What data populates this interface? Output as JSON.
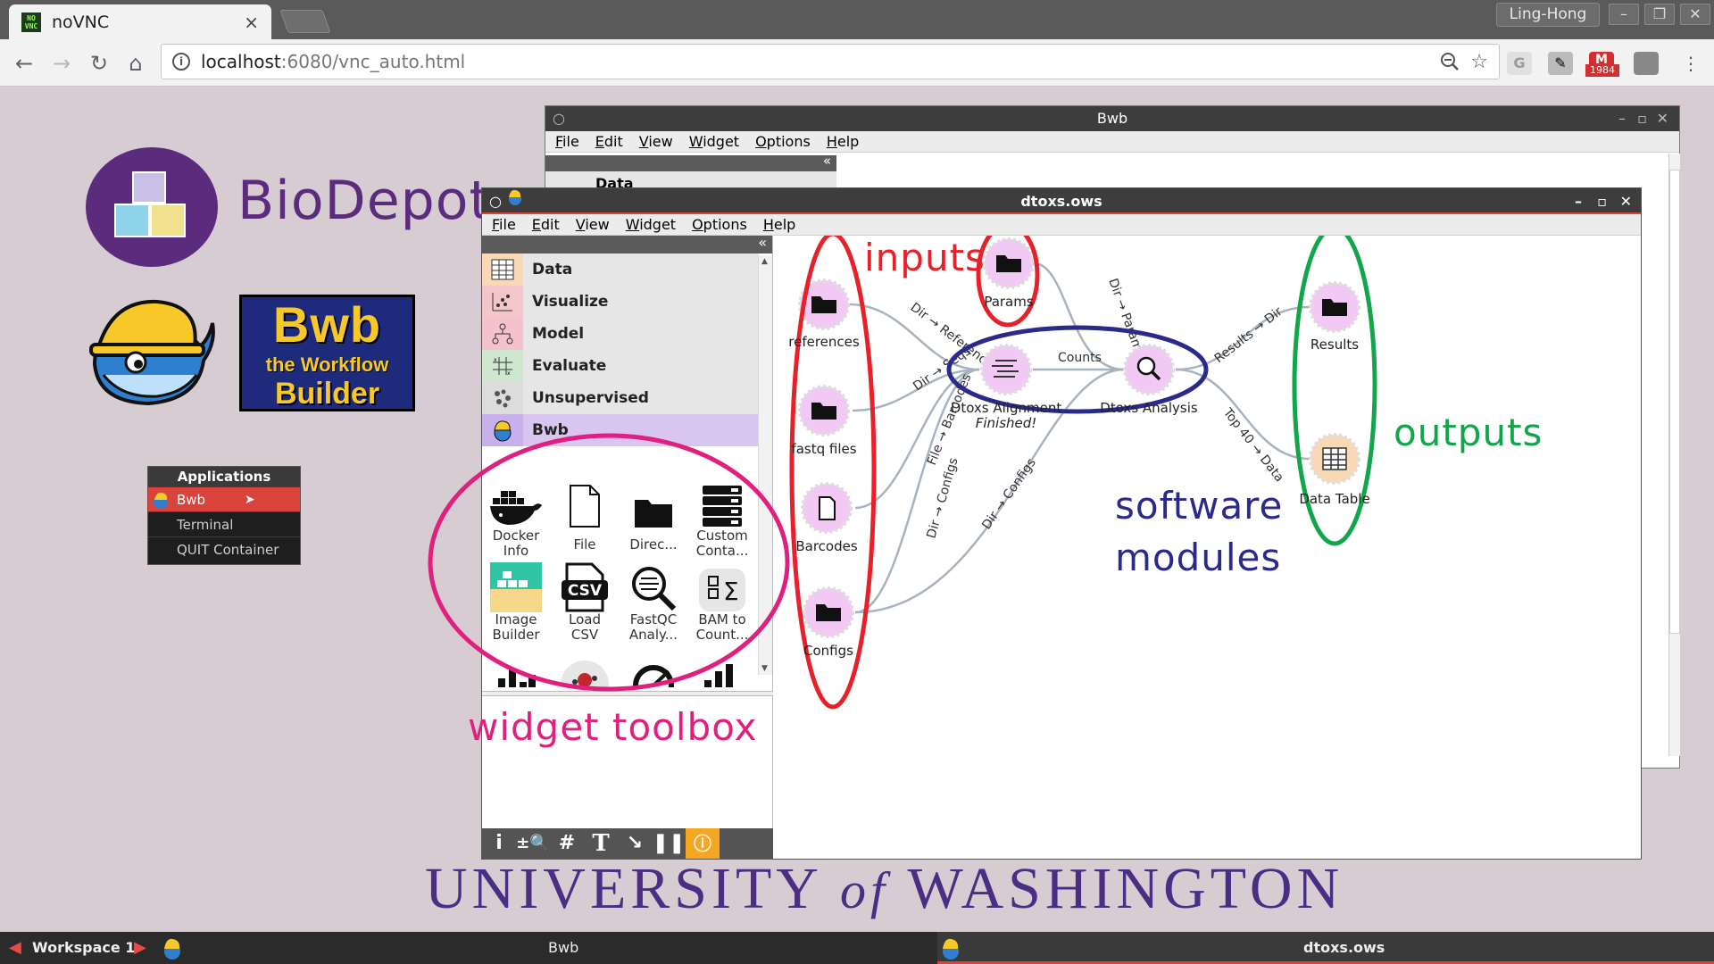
{
  "browser": {
    "tab_title": "noVNC",
    "tab_close": "×",
    "profile": "Ling-Hong",
    "url_host": "localhost",
    "url_rest": ":6080/vnc_auto.html",
    "badge_count": "1984",
    "favicon_text": "NO VNC"
  },
  "desktop": {
    "biodepot": "BioDepot",
    "bwb_logo": {
      "line1": "Bwb",
      "line2": "the Workflow",
      "line3": "Builder"
    },
    "applications_menu": {
      "title": "Applications",
      "items": [
        "Bwb",
        "Terminal",
        "QUIT Container"
      ]
    },
    "university": {
      "part1": "UNIVERSITY",
      "of": "of",
      "part2": "WASHINGTON"
    }
  },
  "bwb_window": {
    "title": "Bwb",
    "menu": [
      "File",
      "Edit",
      "View",
      "Widget",
      "Options",
      "Help"
    ],
    "partial_category": "Data"
  },
  "dtoxs_window": {
    "title": "dtoxs.ows",
    "menu": [
      "File",
      "Edit",
      "View",
      "Widget",
      "Options",
      "Help"
    ],
    "categories": [
      "Data",
      "Visualize",
      "Model",
      "Evaluate",
      "Unsupervised",
      "Bwb"
    ],
    "widgets": [
      {
        "label": "Docker\nInfo"
      },
      {
        "label": "File"
      },
      {
        "label": "Direc..."
      },
      {
        "label": "Custom\nConta..."
      },
      {
        "label": "Image\nBuilder"
      },
      {
        "label": "Load\nCSV"
      },
      {
        "label": "FastQC\nAnaly..."
      },
      {
        "label": "BAM to\nCount..."
      }
    ],
    "csv_icon_text": "CSV"
  },
  "workflow": {
    "nodes": {
      "params": "Params",
      "references": "references",
      "fastq": "fastq files",
      "barcodes": "Barcodes",
      "configs": "Configs",
      "alignment": "Dtoxs Alignment",
      "alignment_status": "Finished!",
      "analysis": "Dtoxs Analysis",
      "results": "Results",
      "data_table": "Data Table"
    },
    "edges": {
      "dir_params": "Dir → Params",
      "dir_references": "Dir → References",
      "dir_seqs": "Dir → Seqs",
      "file_barcodes": "File → Barcodes",
      "dir_configs_1": "Dir → Configs",
      "dir_configs_2": "Dir → Configs",
      "counts": "Counts",
      "results_dir": "Results → Dir",
      "top40_data": "Top 40 → Data"
    }
  },
  "annotations": {
    "inputs": "inputs",
    "outputs": "outputs",
    "software_line1": "software",
    "software_line2": "modules",
    "widget_toolbox": "widget toolbox"
  },
  "taskbar": {
    "workspace": "Workspace 1",
    "task1": "Bwb",
    "task2": "dtoxs.ows"
  },
  "colors": {
    "annotation_red": "#e8202a",
    "annotation_green": "#12a64a",
    "annotation_blue": "#2a2a8a",
    "annotation_pink": "#e0207f",
    "bwb_purple": "#5b2c7d",
    "uw_purple": "#4b2e83",
    "node_pink": "#f2c9f4",
    "node_orange": "#f9d9b5",
    "selected_red": "#d9433b"
  }
}
